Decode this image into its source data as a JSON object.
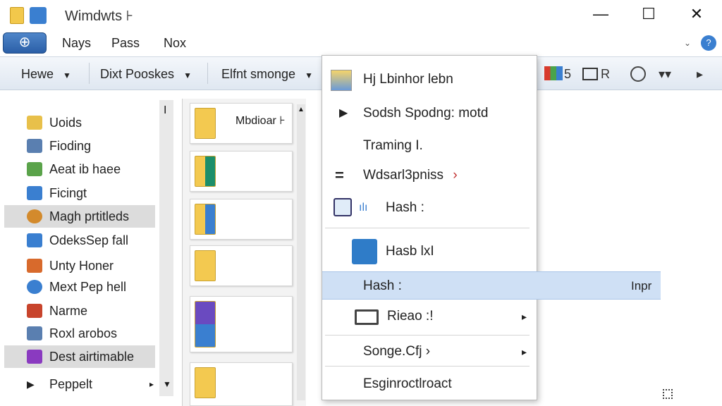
{
  "window": {
    "title": "Wimdwts ⊦",
    "controls": {
      "minimize": "—",
      "maximize": "☐",
      "close": "✕"
    }
  },
  "menubar": {
    "app_button": "⊕",
    "items": [
      "Nays",
      "Pass",
      "Nox"
    ],
    "help_label": "?"
  },
  "toolbar": {
    "items": [
      {
        "label": "Hewe",
        "icon": "chevron-down-icon"
      },
      {
        "label": "Dixt Pooskes",
        "icon": "chevron-down-icon"
      },
      {
        "label": "Elfnt smonge",
        "icon": "chevron-down-icon"
      }
    ],
    "right_icons": [
      "puzzle-icon",
      "tiles-icon",
      "grid-icon",
      "history-icon",
      "double-chevron-icon",
      "arrow-right-icon"
    ],
    "right_texts": [
      "5",
      "R",
      "▾▾",
      "▸"
    ]
  },
  "sidebar": {
    "header_marker": "I",
    "items": [
      {
        "label": "Uoids",
        "icon": "folder-icon",
        "color": "#e8c04a"
      },
      {
        "label": "Fioding",
        "icon": "document-icon",
        "color": "#5a7fb0"
      },
      {
        "label": "Aeat ib haee",
        "icon": "network-icon",
        "color": "#5aa34a"
      },
      {
        "label": "Ficingt",
        "icon": "drive-icon",
        "color": "#3a7fd0"
      },
      {
        "label": "Magh prtitleds",
        "icon": "globe-icon",
        "color": "#d38a2c",
        "selected": true
      },
      {
        "label": "OdeksSep fall",
        "icon": "puzzle-icon",
        "color": "#3a7fd0"
      },
      {
        "label": "Unty Honer",
        "icon": "list-icon",
        "color": "#d86a2c"
      },
      {
        "label": "Mext Pep hell",
        "icon": "settings-icon",
        "color": "#3a7fd0"
      },
      {
        "label": "Narme",
        "icon": "app-icon",
        "color": "#c8442c"
      },
      {
        "label": "Roxl arobos",
        "icon": "table-icon",
        "color": "#5a7fb0"
      },
      {
        "label": "Dest airtimable",
        "icon": "media-icon",
        "color": "#8a3ac0",
        "selected": true
      },
      {
        "label": "Peppelt",
        "icon": "expand-icon",
        "color": "#222222"
      }
    ],
    "more_arrow": "▸"
  },
  "filepane": {
    "cards": [
      {
        "label": "Mbdioar ⊦",
        "icon": "folder-icon"
      },
      {
        "label": "",
        "icon": "play-folder-icon"
      },
      {
        "label": "",
        "icon": "video-icon"
      },
      {
        "label": "",
        "icon": "folder-icon"
      },
      {
        "label": "",
        "icon": "app-folder-icon"
      },
      {
        "label": "",
        "icon": "folder-icon"
      }
    ]
  },
  "context_menu": {
    "items": [
      {
        "label": "Hj Lbinhor lebn",
        "icon": "document-icon"
      },
      {
        "label": "Sodsh Spodng: motd",
        "icon": "play-icon"
      },
      {
        "label": "Traming I.",
        "icon": ""
      },
      {
        "label": "Wdsarl3pniss",
        "icon": "equals-icon",
        "arrow": "›"
      },
      {
        "label": "Hash :",
        "icon": "monitor-icon"
      },
      {
        "label": "Hasb lxI",
        "icon": "box-icon"
      },
      {
        "label": "Hash :",
        "icon": "",
        "highlighted": true,
        "right_text": "Inpr"
      },
      {
        "label": "Rieao :!",
        "icon": "printer-icon",
        "arrow": "▸"
      },
      {
        "label": "Songe.Cfj ›",
        "icon": "",
        "arrow": "▸"
      },
      {
        "label": "Esginroctlroact",
        "icon": ""
      }
    ]
  },
  "colors": {
    "accent": "#2b5fa7",
    "highlight": "#cfe0f5",
    "selection": "#dcdcdc",
    "folder": "#f2c84b"
  }
}
